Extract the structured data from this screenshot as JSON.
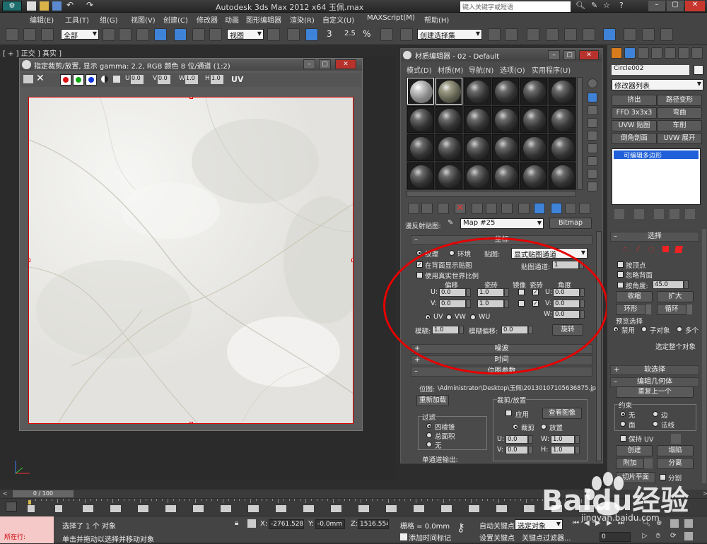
{
  "app": {
    "title": "Autodesk 3ds Max  2012 x64    玉佩.max",
    "search_placeholder": "键入关键字或短语"
  },
  "menu": {
    "items": [
      "编辑(E)",
      "工具(T)",
      "组(G)",
      "视图(V)",
      "创建(C)",
      "修改器",
      "动画",
      "图形编辑器",
      "渲染(R)",
      "自定义(U)",
      "MAXScript(M)",
      "帮助(H)"
    ]
  },
  "toolbar": {
    "selection_filter": "全部",
    "ref_coord": "视图",
    "named_set": "创建选择集",
    "snap_3": "3",
    "snap_2_5": "2.5",
    "percent_snap": "%"
  },
  "viewport": {
    "label": "[ + ] 正交 ] 真实 ]"
  },
  "image_window": {
    "title": "指定裁剪/放置, 显示 gamma: 2.2, RGB 颜色 8 位/通道 (1:2)",
    "u_label": "U",
    "u_val": "0.0",
    "v_label": "V",
    "v_val": "0.0",
    "w_label": "W",
    "w_val": "1.0",
    "h_label": "H",
    "h_val": "1.0",
    "uv_label": "UV"
  },
  "material_editor": {
    "title": "材质编辑器 - 02 - Default",
    "menu": [
      "模式(D)",
      "材质(M)",
      "导航(N)",
      "选项(O)",
      "实用程序(U)"
    ],
    "map_label": "漫反射贴图:",
    "map_name": "Map #25",
    "map_type": "Bitmap",
    "coordinates": {
      "header": "坐标",
      "texture": "纹理",
      "environ": "环境",
      "mapping_label": "贴图:",
      "mapping_value": "显式贴图通道",
      "show_back": "在背面显示贴图",
      "map_channel_label": "贴图通道:",
      "map_channel": "1",
      "real_world": "使用真实世界比例",
      "offset": "偏移",
      "tiling": "瓷砖",
      "mirror": "镜像",
      "tile": "瓷砖",
      "angle": "角度",
      "u": "U:",
      "v": "V:",
      "w": "W:",
      "u_offset": "0.0",
      "v_offset": "0.0",
      "u_tiling": "1.0",
      "v_tiling": "1.0",
      "u_angle": "0.0",
      "v_angle": "0.0",
      "w_angle": "0.0",
      "uv": "UV",
      "vw": "VW",
      "wu": "WU",
      "blur_label": "模糊:",
      "blur": "1.0",
      "blur_offset_label": "模糊偏移:",
      "blur_offset": "0.0",
      "rotate": "旋转"
    },
    "noise": "噪波",
    "time": "时间",
    "bitmap": {
      "header": "位图参数",
      "path_label": "位图:",
      "path": "\\Administrator\\Desktop\\玉佩\\20130107105636875.jpg",
      "reload": "重新加载",
      "crop_place": "裁剪/放置",
      "apply": "应用",
      "view_image": "查看图像",
      "crop": "裁剪",
      "place": "放置",
      "filter": "过滤",
      "pyramidal": "四棱锥",
      "summed": "总面积",
      "none": "无",
      "u_label": "U:",
      "u_val": "0.0",
      "v_label": "V:",
      "v_val": "0.0",
      "w_label": "W:",
      "w_val": "1.0",
      "h_label": "H:",
      "h_val": "1.0",
      "mono_out": "单通道输出:"
    }
  },
  "command_panel": {
    "object_name": "Circle002",
    "modifier_list": "修改器列表",
    "mod_buttons": [
      "挤出",
      "路径变形",
      "FFD 3x3x3",
      "弯曲",
      "UVW 贴图",
      "车削",
      "倒角剖面",
      "UVW 展开"
    ],
    "stack_item": "可编辑多边形",
    "selection": "选择",
    "by_vertex": "按顶点",
    "ignore_back": "忽略背面",
    "by_angle": "按角度:",
    "angle_val": "45.0",
    "shrink": "收缩",
    "grow": "扩大",
    "ring": "环形",
    "loop": "循环",
    "preview": "预览选择",
    "disabled": "禁用",
    "subobj": "子对象",
    "multi": "多个",
    "whole": "选定整个对象",
    "soft_sel": "软选择",
    "edit_geom": "编辑几何体",
    "repeat": "重复上一个",
    "constraint": "约束",
    "c_none": "无",
    "c_edge": "边",
    "c_face": "面",
    "c_normal": "法线",
    "preserve_uv": "保持 UV",
    "create": "创建",
    "collapse": "塌陷",
    "attach": "附加",
    "detach": "分离",
    "slice_plane": "切片平面",
    "split": "分割",
    "slice": "切片",
    "reset_plane": "重置平面",
    "quickslice": "快速切片",
    "cut": "切割"
  },
  "timeline": {
    "position": "0 / 100",
    "ticks": [
      "0",
      "5",
      "10",
      "15",
      "20",
      "25",
      "30",
      "35",
      "40",
      "45",
      "50",
      "55",
      "60",
      "65",
      "70",
      "75",
      "80",
      "85",
      "90",
      "95",
      "100"
    ]
  },
  "status": {
    "selected": "选择了 1 个 对象",
    "hint": "单击并拖动以选择并移动对象",
    "in_place": "所在行:",
    "x_label": "X:",
    "x_val": "-2761.528(",
    "y_label": "Y:",
    "y_val": "-0.0mm",
    "z_label": "Z:",
    "z_val": "1516.554m",
    "grid": "栅格 = 0.0mm",
    "add_time_tag": "添加时间标记",
    "auto_key": "自动关键点",
    "set_key": "设置关键点",
    "key_mode": "选定对象",
    "key_filters": "关键点过滤器...",
    "frame": "0"
  },
  "watermark": {
    "text": "Baidu经验",
    "url": "jingyan.baidu.com"
  }
}
